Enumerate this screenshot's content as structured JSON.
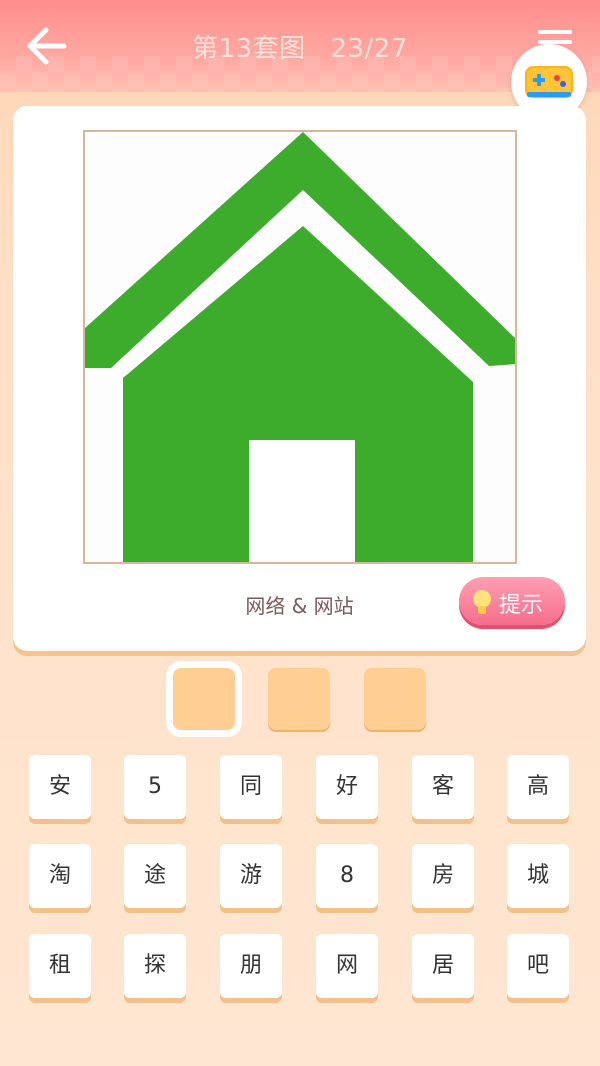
{
  "header": {
    "title": "第13套图",
    "progress": "23/27",
    "colors": {
      "bar": "#ff9a96",
      "text": "#ffe2dc"
    }
  },
  "icons": {
    "back": "arrow-left-icon",
    "menu": "hamburger-menu-icon",
    "game": "gamepad-icon",
    "hint": "lightbulb-icon"
  },
  "puzzle": {
    "image": "green-house-icon",
    "category": "网络 & 网站",
    "hint_label": "提示",
    "answer_slots": 3,
    "active_slot": 1,
    "image_color": "#3dab2c"
  },
  "keys": [
    [
      "安",
      "5",
      "同",
      "好",
      "客",
      "高"
    ],
    [
      "淘",
      "途",
      "游",
      "8",
      "房",
      "城"
    ],
    [
      "租",
      "探",
      "朋",
      "网",
      "居",
      "吧"
    ]
  ]
}
